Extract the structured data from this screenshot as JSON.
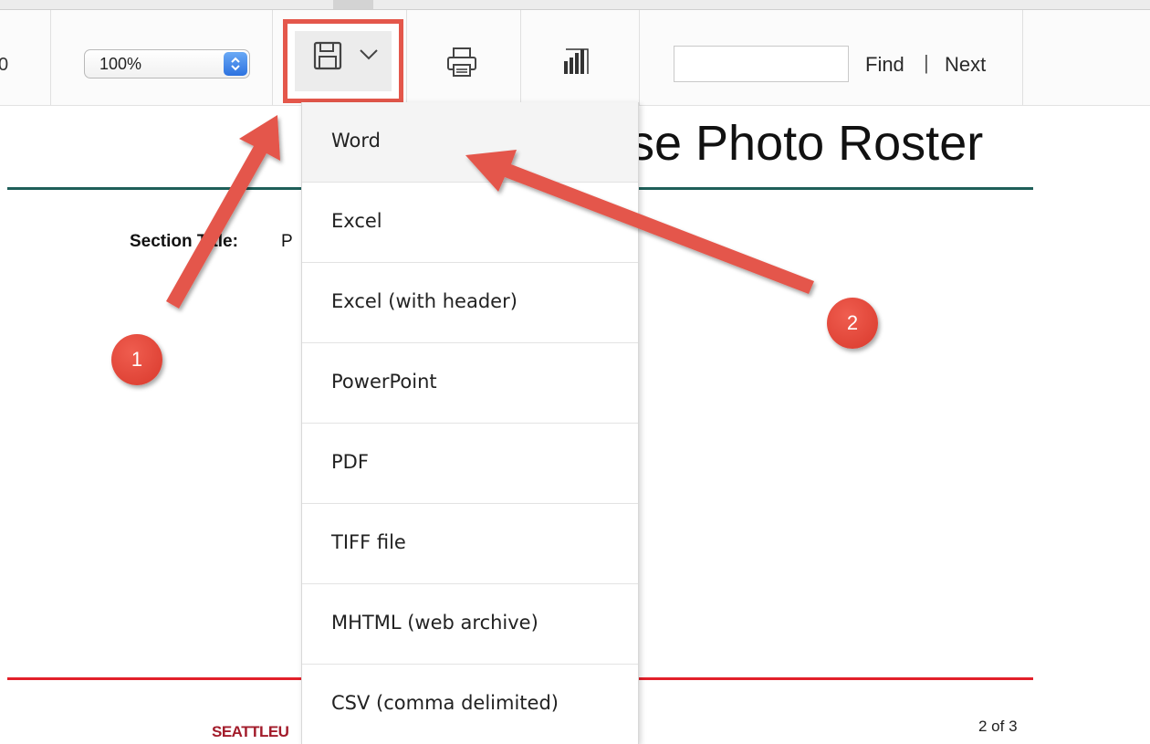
{
  "toolbar": {
    "prev_page_num_fragment": "0",
    "zoom_value": "100%",
    "save_icon": "floppy-disk-icon",
    "save_dropdown_icon": "chevron-down-icon",
    "print_icon": "printer-icon",
    "powerbi_icon": "powerbi-icon",
    "find_input_value": "",
    "find_label": "Find",
    "separator": "|",
    "next_label": "Next"
  },
  "export_menu": {
    "items": [
      {
        "label": "Word"
      },
      {
        "label": "Excel"
      },
      {
        "label": "Excel (with header)"
      },
      {
        "label": "PowerPoint"
      },
      {
        "label": "PDF"
      },
      {
        "label": "TIFF file"
      },
      {
        "label": "MHTML (web archive)"
      },
      {
        "label": "CSV (comma delimited)"
      }
    ]
  },
  "report": {
    "title_fragment": "se Photo Roster",
    "section_label": "Section Title:",
    "section_value_fragment": "P",
    "footer_logo": "SEATTLEU",
    "page_indicator": "2 of 3"
  },
  "annotations": {
    "badge1": "1",
    "badge2": "2",
    "color": "#e4574b"
  }
}
